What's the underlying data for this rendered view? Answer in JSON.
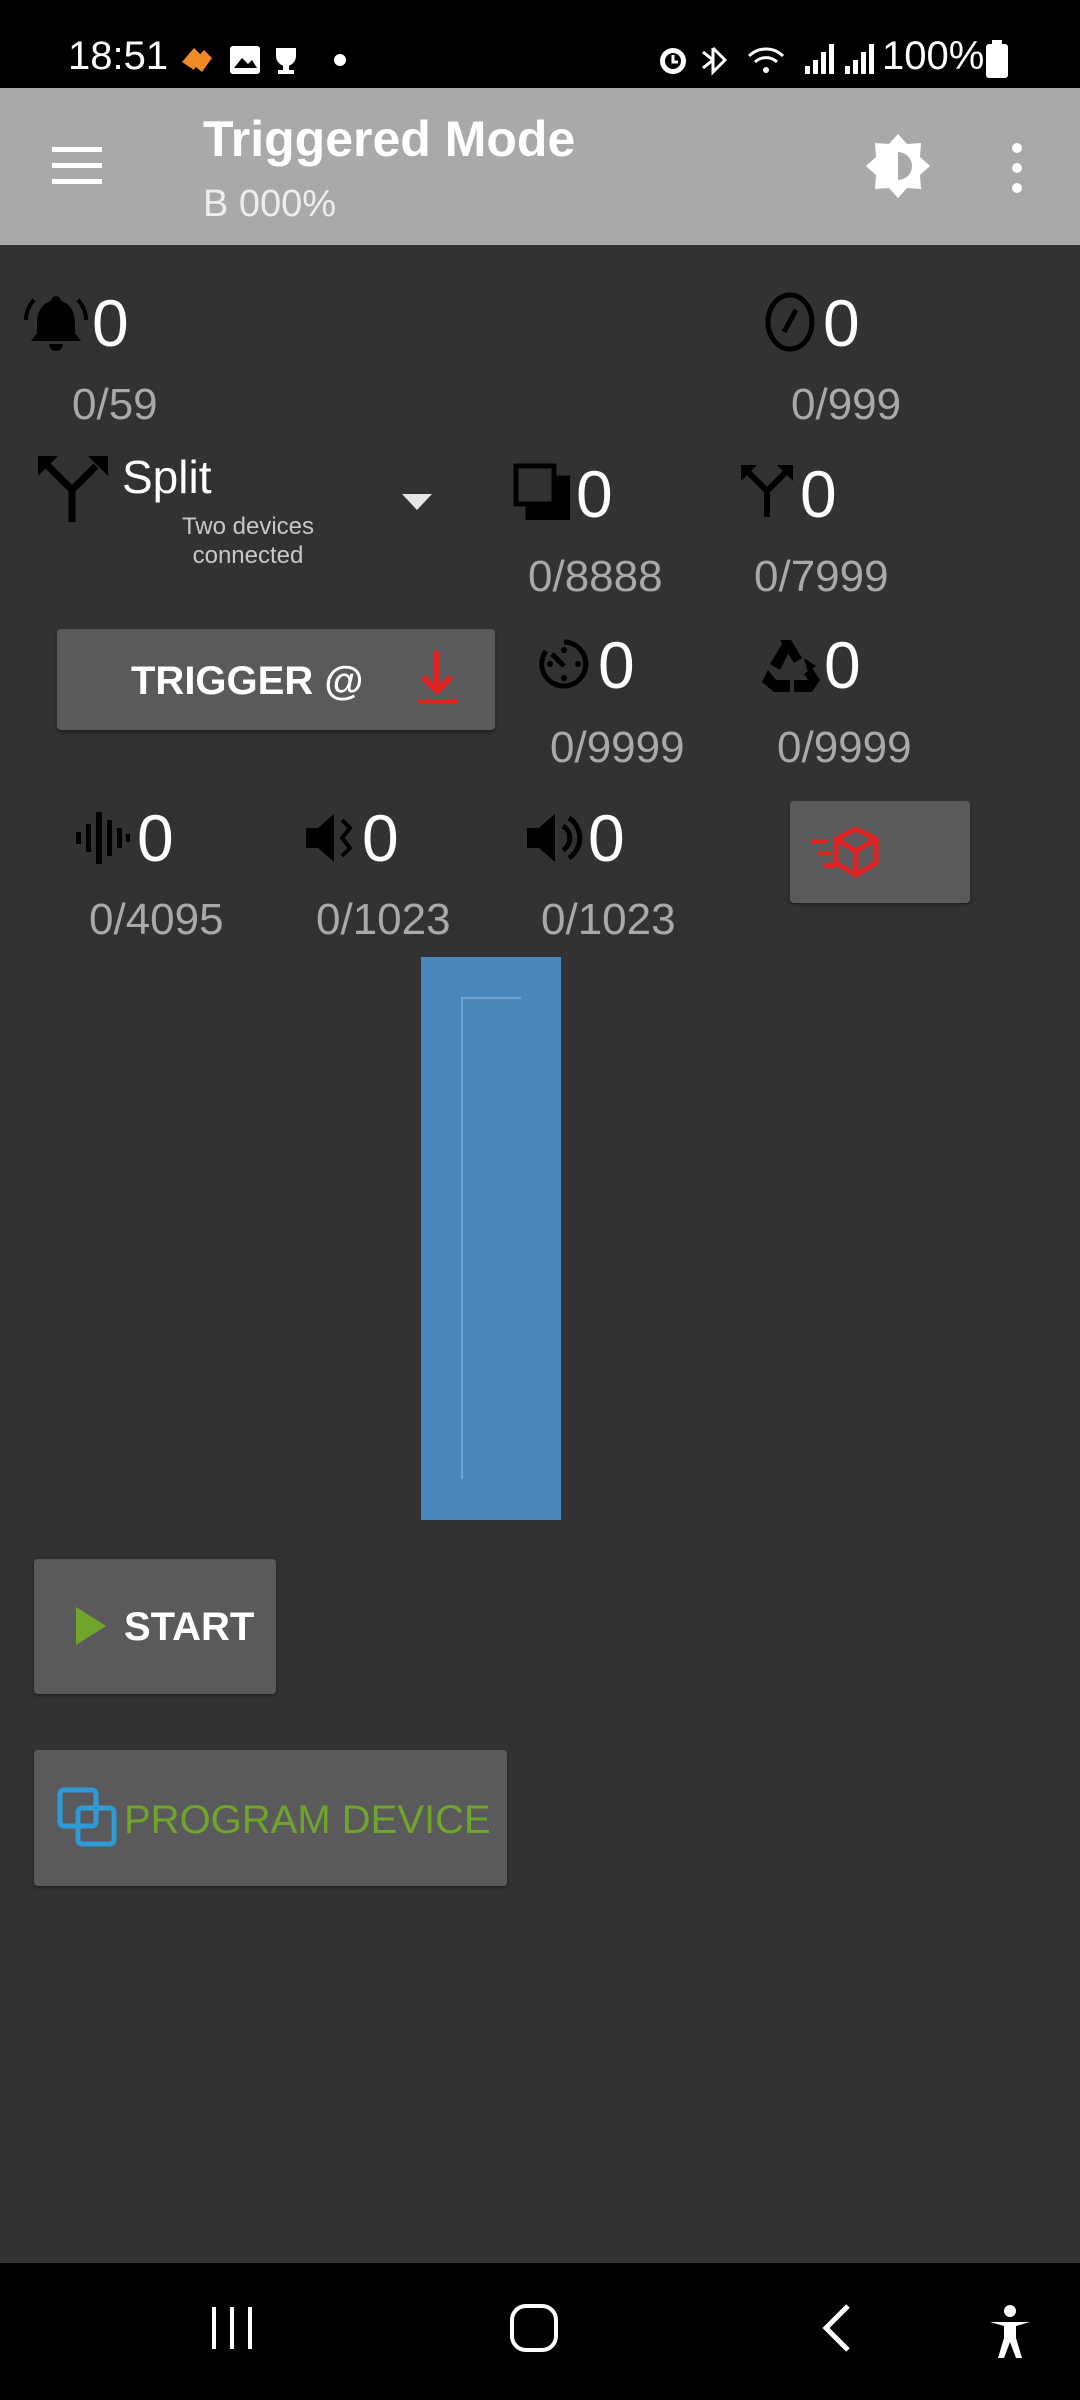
{
  "status_bar": {
    "time": "18:51",
    "battery": "100%",
    "icons": [
      "hearts-icon",
      "gallery-icon",
      "trophy-icon",
      "dot-icon",
      "alarm-icon",
      "bluetooth-icon",
      "wifi-icon",
      "signal-icon",
      "signal2-icon",
      "battery-icon"
    ]
  },
  "app_bar": {
    "title": "Triggered Mode",
    "subtitle": "B 000%"
  },
  "counters": {
    "bell": {
      "value": "0",
      "max": "0/59"
    },
    "edit_circle": {
      "value": "0",
      "max": "0/999"
    },
    "copy": {
      "value": "0",
      "max": "0/8888"
    },
    "fork": {
      "value": "0",
      "max": "0/7999"
    },
    "timer": {
      "value": "0",
      "max": "0/9999"
    },
    "recycle": {
      "value": "0",
      "max": "0/9999"
    },
    "waveform": {
      "value": "0",
      "max": "0/4095"
    },
    "volume_low": {
      "value": "0",
      "max": "0/1023"
    },
    "volume_high": {
      "value": "0",
      "max": "0/1023"
    }
  },
  "split": {
    "label": "Split",
    "sub": "Two devices connected"
  },
  "trigger_button": {
    "label": "TRIGGER @"
  },
  "start_button": {
    "label": "START"
  },
  "program_button": {
    "label": "PROGRAM DEVICE"
  },
  "colors": {
    "accent_red": "#e02020",
    "accent_green": "#6ea52a",
    "bar_blue": "#4a87bd"
  }
}
